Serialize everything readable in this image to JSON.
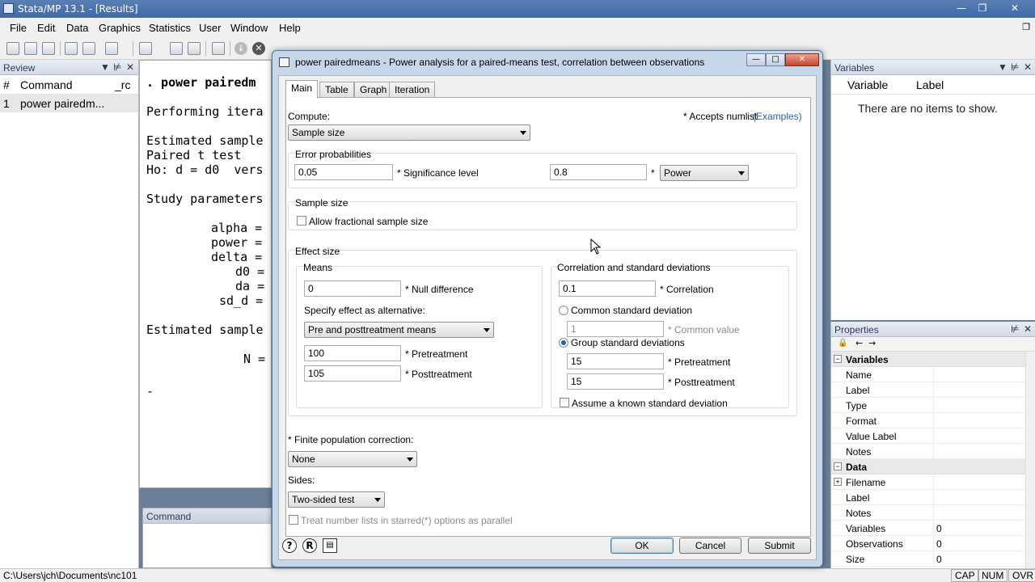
{
  "app": {
    "title": "Stata/MP 13.1 - [Results]",
    "menu": [
      "File",
      "Edit",
      "Data",
      "Graphics",
      "Statistics",
      "User",
      "Window",
      "Help"
    ]
  },
  "review": {
    "title": "Review",
    "col_num": "#",
    "col_command": "Command",
    "col_rc": "_rc",
    "rows": [
      {
        "num": "1",
        "command": "power pairedm..."
      }
    ]
  },
  "results": {
    "lines": [
      ". power pairedm",
      "Performing itera",
      "Estimated sample",
      "Paired t test",
      "Ho: d = d0  vers",
      "Study parameters",
      "alpha =",
      "power =",
      "delta =",
      "d0 =",
      "da =",
      "sd_d =",
      "Estimated sample",
      "N =",
      "-"
    ]
  },
  "command_panel": {
    "title": "Command"
  },
  "variables": {
    "title": "Variables",
    "col_variable": "Variable",
    "col_label": "Label",
    "empty_text": "There are no items to show."
  },
  "properties": {
    "title": "Properties",
    "sections": [
      {
        "name": "Variables",
        "rows": [
          {
            "key": "Name",
            "value": ""
          },
          {
            "key": "Label",
            "value": ""
          },
          {
            "key": "Type",
            "value": ""
          },
          {
            "key": "Format",
            "value": ""
          },
          {
            "key": "Value Label",
            "value": ""
          },
          {
            "key": "Notes",
            "value": ""
          }
        ]
      },
      {
        "name": "Data",
        "rows": [
          {
            "key": "Filename",
            "value": ""
          },
          {
            "key": "Label",
            "value": ""
          },
          {
            "key": "Notes",
            "value": ""
          },
          {
            "key": "Variables",
            "value": "0"
          },
          {
            "key": "Observations",
            "value": "0"
          },
          {
            "key": "Size",
            "value": "0"
          }
        ]
      }
    ]
  },
  "statusbar": {
    "path": "C:\\Users\\jch\\Documents\\nc101",
    "indicators": [
      "CAP",
      "NUM",
      "OVR"
    ]
  },
  "dialog": {
    "title": "power pairedmeans - Power analysis for a paired-means test, correlation between observations",
    "tabs": [
      "Main",
      "Table",
      "Graph",
      "Iteration"
    ],
    "compute_label": "Compute:",
    "compute_value": "Sample size",
    "accepts_numlist": "* Accepts numlist",
    "examples_link": "(Examples)",
    "error_prob": {
      "title": "Error probabilities",
      "alpha_value": "0.05",
      "alpha_label": "* Significance level",
      "power_value": "0.8",
      "star": "*",
      "power_select": "Power"
    },
    "sample_size": {
      "title": "Sample size",
      "fractional_label": "Allow fractional sample size"
    },
    "effect_size": {
      "title": "Effect size",
      "means_title": "Means",
      "null_value": "0",
      "null_label": "* Null difference",
      "specify_label": "Specify effect as alternative:",
      "specify_value": "Pre and posttreatment means",
      "pre_value": "100",
      "pre_label": "* Pretreatment",
      "post_value": "105",
      "post_label": "* Posttreatment",
      "corr_title": "Correlation and standard deviations",
      "corr_value": "0.1",
      "corr_label": "* Correlation",
      "common_sd_label": "Common standard deviation",
      "common_value": "1",
      "common_value_label": "* Common value",
      "group_sd_label": "Group standard deviations",
      "group_pre_value": "15",
      "group_pre_label": "* Pretreatment",
      "group_post_value": "15",
      "group_post_label": "* Posttreatment",
      "known_sd_label": "Assume a known standard deviation"
    },
    "fpc_label": "* Finite population correction:",
    "fpc_value": "None",
    "sides_label": "Sides:",
    "sides_value": "Two-sided test",
    "parallel_label": "Treat number lists in starred(*) options as parallel",
    "ok": "OK",
    "cancel": "Cancel",
    "submit": "Submit"
  }
}
